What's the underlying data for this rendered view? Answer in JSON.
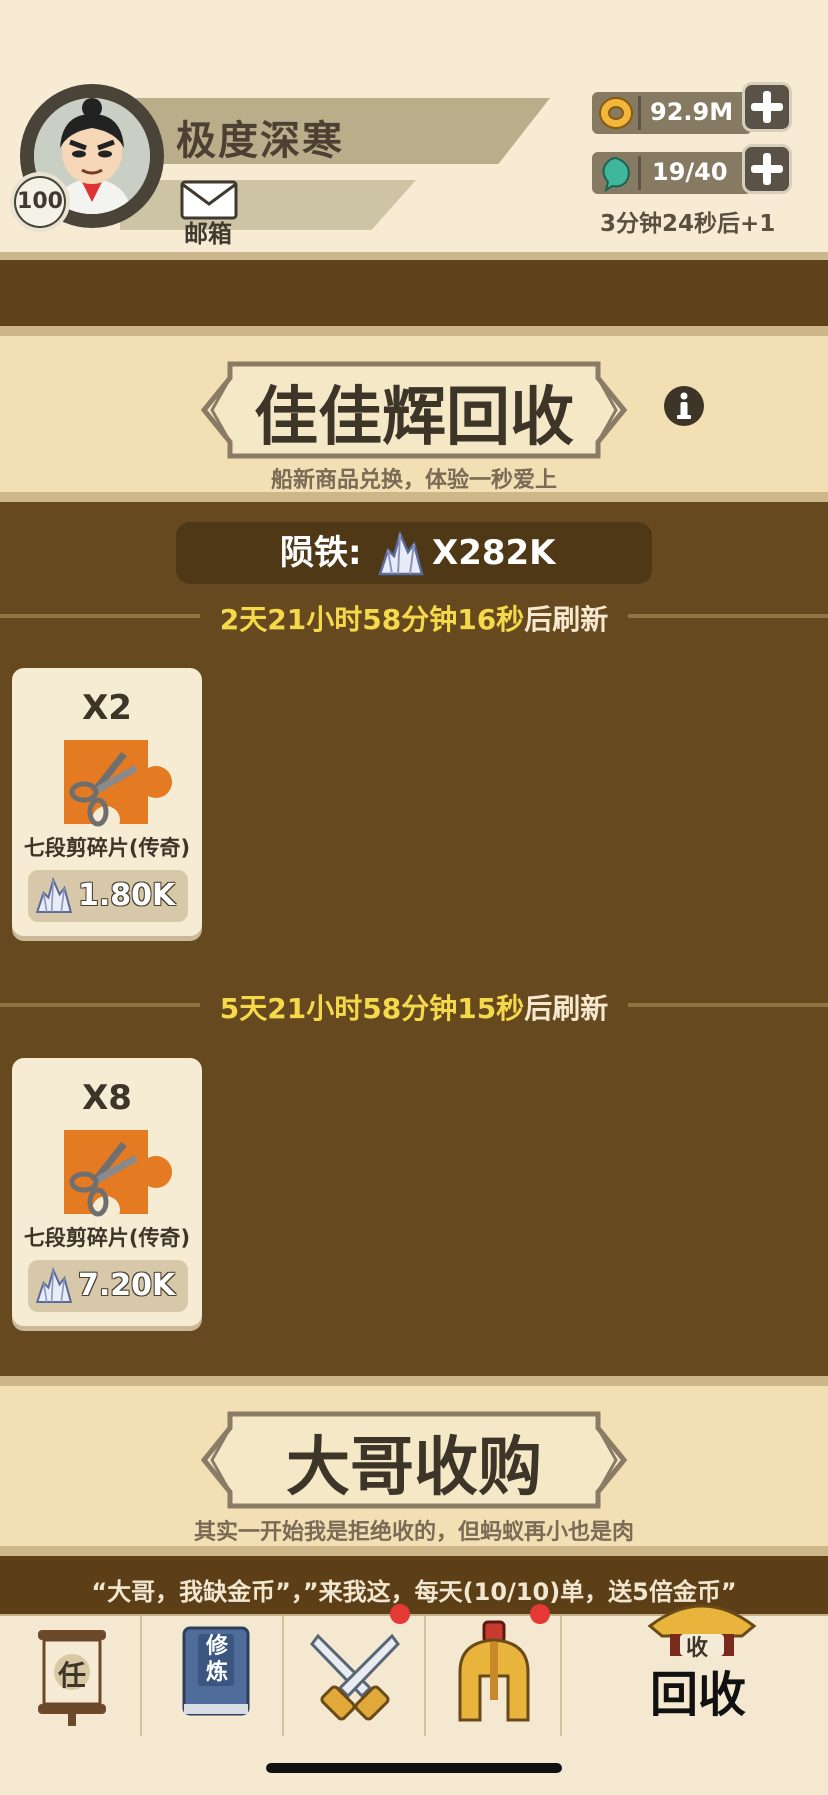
{
  "player": {
    "name": "极度深寒",
    "level": "100",
    "mail_label": "邮箱"
  },
  "resources": {
    "gold": "92.9M",
    "energy": "19/40",
    "energy_regen": "3分钟24秒后+1"
  },
  "section_recycle": {
    "title": "佳佳辉回收",
    "subtitle": "船新商品兑换，体验一秒爱上"
  },
  "currency": {
    "label": "陨铁:",
    "amount": "X282K"
  },
  "offers": [
    {
      "timer_value": "2天21小时58分钟16秒",
      "timer_suffix": "后刷新",
      "qty": "X2",
      "item_name": "七段剪碎片(传奇)",
      "price": "1.80K"
    },
    {
      "timer_value": "5天21小时58分钟15秒",
      "timer_suffix": "后刷新",
      "qty": "X8",
      "item_name": "七段剪碎片(传奇)",
      "price": "7.20K"
    }
  ],
  "section_buyback": {
    "title": "大哥收购",
    "subtitle": "其实一开始我是拒绝收的，但蚂蚁再小也是肉"
  },
  "promo_text": "“大哥，我缺金币”，”来我这，每天(10/10)单，送5倍金币”",
  "nav": {
    "tasks_label": "任",
    "cultivate_label": "修炼",
    "recycle_badge": "收",
    "recycle_label": "回收"
  },
  "colors": {
    "accent_yellow": "#f6d94a",
    "badge_red": "#e53935",
    "bg_brown": "#66491f"
  }
}
